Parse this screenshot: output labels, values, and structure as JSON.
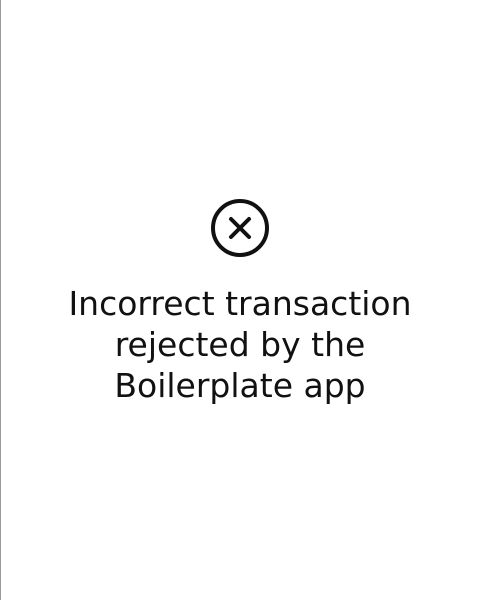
{
  "status": {
    "icon": "circle-x-icon",
    "icon_color": "#111111",
    "message_lines": [
      "Incorrect transaction",
      "rejected by the",
      "Boilerplate app"
    ]
  }
}
